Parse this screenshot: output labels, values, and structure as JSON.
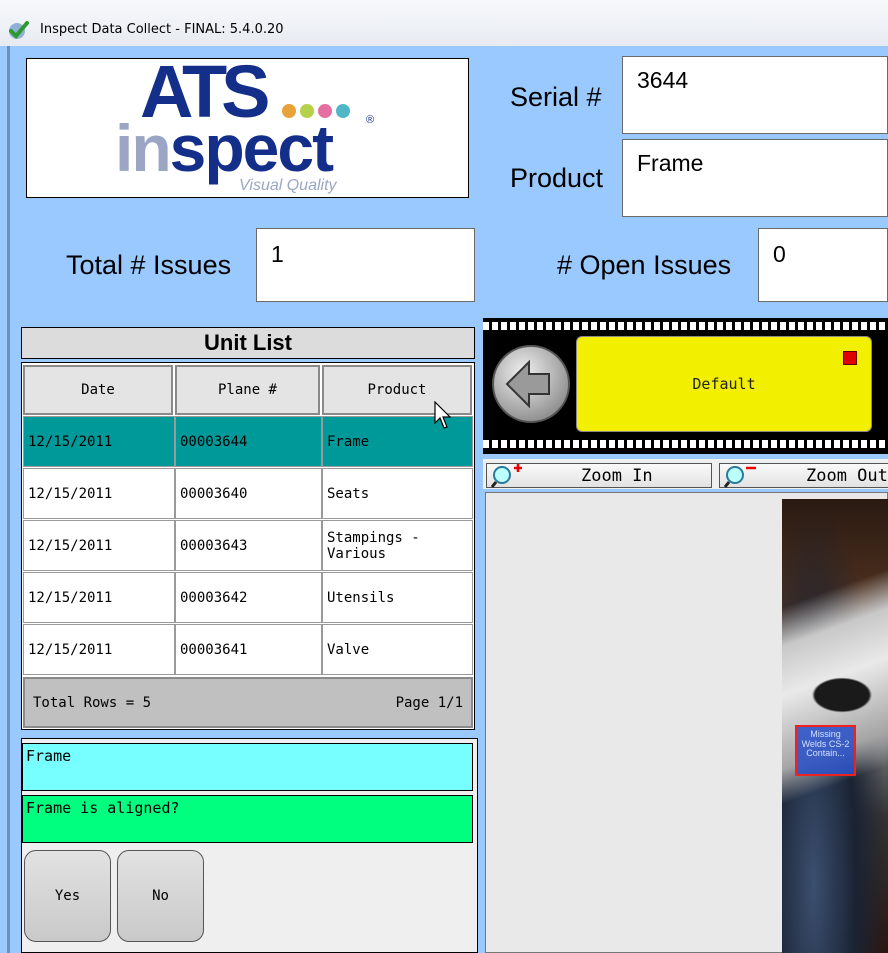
{
  "window": {
    "title": "Inspect Data Collect - FINAL: 5.4.0.20"
  },
  "logo": {
    "brand": "ATS",
    "product": "inspect",
    "tagline": "Visual Quality",
    "registered": "®"
  },
  "header": {
    "serial_label": "Serial #",
    "serial_value": "3644",
    "product_label": "Product",
    "product_value": "Frame",
    "total_issues_label": "Total # Issues",
    "total_issues_value": "1",
    "open_issues_label": "# Open Issues",
    "open_issues_value": "0"
  },
  "unit_list": {
    "title": "Unit List",
    "columns": [
      "Date",
      "Plane #",
      "Product"
    ],
    "rows": [
      {
        "date": "12/15/2011",
        "plane": "00003644",
        "product": "Frame",
        "selected": true
      },
      {
        "date": "12/15/2011",
        "plane": "00003640",
        "product": "Seats"
      },
      {
        "date": "12/15/2011",
        "plane": "00003643",
        "product": "Stampings - Various"
      },
      {
        "date": "12/15/2011",
        "plane": "00003642",
        "product": "Utensils"
      },
      {
        "date": "12/15/2011",
        "plane": "00003641",
        "product": "Valve"
      }
    ],
    "total_rows": "Total Rows = 5",
    "page": "Page 1/1"
  },
  "question": {
    "category": "Frame",
    "text": "Frame is aligned?",
    "yes_label": "Yes",
    "no_label": "No"
  },
  "filmstrip": {
    "tile_label": "Default"
  },
  "zoom": {
    "zoom_in_label": "Zoom In",
    "zoom_out_label": "Zoom Out"
  },
  "image_viewer": {
    "defect_marker": "Missing Welds CS-2 Contain..."
  },
  "colors": {
    "window_bg": "#99c9ff",
    "selected_row": "#009999",
    "category_box": "#77ffff",
    "question_box": "#00ff7f",
    "default_tile": "#f2ef00"
  }
}
